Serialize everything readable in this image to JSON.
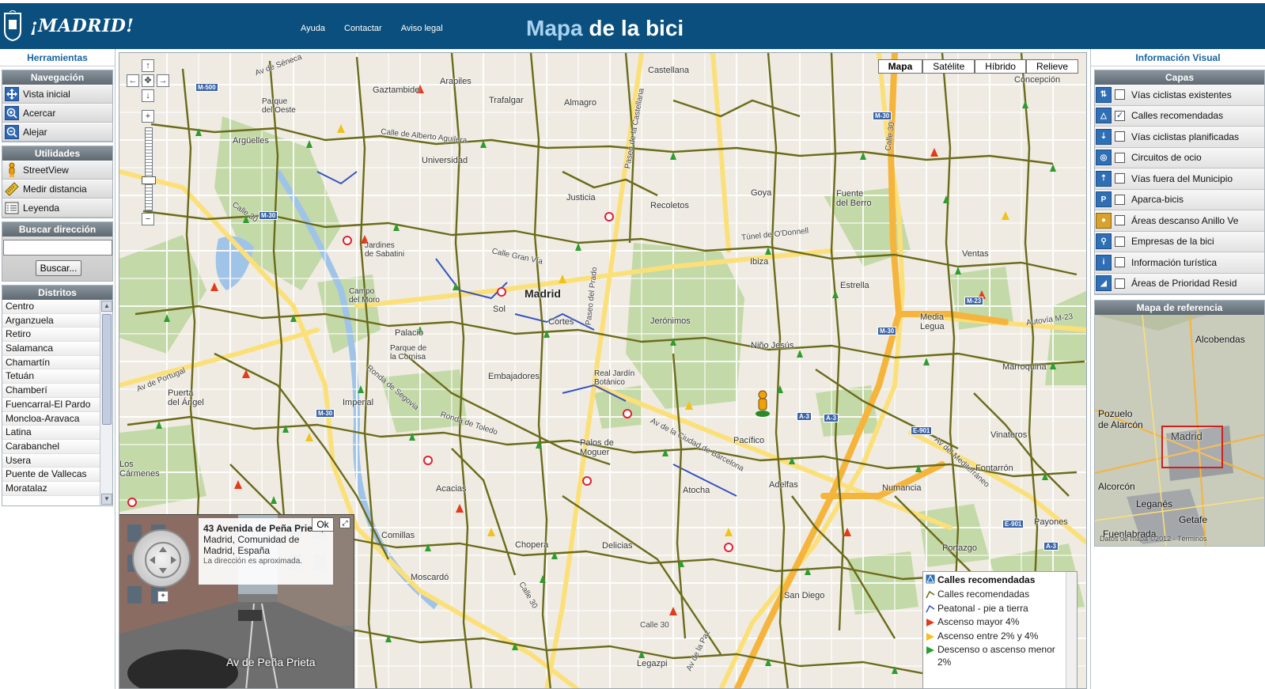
{
  "header": {
    "logo_text": "¡MADRID!",
    "nav": [
      "Ayuda",
      "Contactar",
      "Aviso legal"
    ],
    "title_part1": "Mapa",
    "title_part2": " de la bici"
  },
  "left": {
    "title": "Herramientas",
    "navegacion": {
      "title": "Navegación",
      "items": [
        {
          "label": "Vista inicial",
          "icon": "move-icon"
        },
        {
          "label": "Acercar",
          "icon": "zoom-in-icon"
        },
        {
          "label": "Alejar",
          "icon": "zoom-out-icon"
        }
      ]
    },
    "utilidades": {
      "title": "Utilidades",
      "items": [
        {
          "label": "StreetView",
          "icon": "pegman-icon"
        },
        {
          "label": "Medir distancia",
          "icon": "ruler-icon"
        },
        {
          "label": "Leyenda",
          "icon": "legend-icon"
        }
      ]
    },
    "buscar": {
      "title": "Buscar dirección",
      "value": "",
      "button": "Buscar..."
    },
    "distritos": {
      "title": "Distritos",
      "items": [
        "Centro",
        "Arganzuela",
        "Retiro",
        "Salamanca",
        "Chamartín",
        "Tetuán",
        "Chamberí",
        "Fuencarral-El Pardo",
        "Moncloa-Aravaca",
        "Latina",
        "Carabanchel",
        "Usera",
        "Puente de Vallecas",
        "Moratalaz"
      ]
    }
  },
  "map": {
    "types": [
      "Mapa",
      "Satélite",
      "Híbrido",
      "Relieve"
    ],
    "active_type": "Mapa",
    "labels": {
      "madrid": "Madrid",
      "arapiles": "Arapiles",
      "castellana": "Castellana",
      "gaztambide": "Gaztambide",
      "trafalgar": "Trafalgar",
      "almagro": "Almagro",
      "concepcion": "Concepción",
      "arguelles": "Argüelles",
      "universidad": "Universidad",
      "recoletos": "Recoletos",
      "goya": "Goya",
      "justicia": "Justicia",
      "ibiza": "Ibiza",
      "ventas": "Ventas",
      "palacio": "Palacio",
      "sol": "Sol",
      "cortes": "Cortes",
      "jeronimos": "Jerónimos",
      "nino_jesus": "Niño Jesús",
      "media_legua": "Media\nLegua",
      "embajadores": "Embajadores",
      "imperial": "Imperial",
      "marroquina": "Marroquina",
      "puerta_angel": "Puerta\ndel Ángel",
      "pacifico": "Pacífico",
      "vinateros": "Vinateros",
      "adelfas": "Adelfas",
      "fontarron": "Fontarrón",
      "numancia": "Numancia",
      "atocha": "Atocha",
      "acacias": "Acacias",
      "chopera": "Chopera",
      "delicias": "Delicias",
      "comillas": "Comillas",
      "moscardo": "Moscardó",
      "portazgo": "Portazgo",
      "san_diego": "San Diego",
      "legazpi": "Legazpi",
      "payones": "Payones",
      "los_carmenes": "Los\nCármenes",
      "calle30_a": "Calle 30",
      "calle30_b": "Calle 30",
      "calle30_c": "Calle 30",
      "calle30_d": "Calle 30",
      "av_seneca": "Av de Séneca",
      "av_portugal": "Av de Portugal",
      "av_ciudad_barcelona": "Av de la Ciudad de Barcelona",
      "av_mediterraneo": "Av del Mediterráneo",
      "autovia_m23": "Autovía M-23",
      "tunel_odonnell": "Túnel de O'Donnell",
      "ronda_segovia": "Ronda de Segovia",
      "ronda_toledo": "Ronda de Toledo",
      "calle_gran_via": "Calle Gran Vía",
      "calle_alberto_aguilera": "Calle de Alberto Aguilera",
      "paseo_prado": "Paseo del Prado",
      "paseo_castellana": "Paseo de la Castellana",
      "av_paz": "Av de la Paz",
      "parque_oeste": "Parque\ndel Oeste",
      "real_jardin": "Real Jardín\nBotánico",
      "parque_cornisa": "Parque de\nla Cornisa",
      "campo_moro": "Campo\ndel Moro",
      "jardines_sabatini": "Jardines\nde Sabatini",
      "fuente_berro": "Fuente\ndel Berro",
      "estrella": "Estrella",
      "palos_moguer": "Palos de\nMoguer"
    },
    "hwy_shields": [
      "M-500",
      "M-30",
      "M-30",
      "M-30",
      "M-23",
      "M-30",
      "A-3",
      "A-3",
      "E-901",
      "E-901",
      "A-3"
    ],
    "streetview": {
      "address_bold": "43 Avenida de Peña Prieta",
      "address_rest": ", Madrid, Comunidad de Madrid, España",
      "note": "La dirección es aproximada.",
      "ok": "Ok",
      "street_label": "Av de Peña Prieta"
    },
    "legend": {
      "title": "Calles recomendadas",
      "items": [
        {
          "label": "Calles recomendadas",
          "color": "#6b6b1a"
        },
        {
          "label": "Peatonal - pie a tierra",
          "color": "#3553c0"
        },
        {
          "label": "Ascenso mayor 4%",
          "color": "#e23b1c"
        },
        {
          "label": "Ascenso entre 2% y 4%",
          "color": "#f1c21b"
        },
        {
          "label": "Descenso o ascenso menor 2%",
          "color": "#2f9c2f"
        }
      ]
    }
  },
  "right": {
    "title": "Información Visual",
    "capas": {
      "title": "Capas",
      "items": [
        {
          "label": "Vías ciclistas existentes",
          "checked": false
        },
        {
          "label": "Calles recomendadas",
          "checked": true
        },
        {
          "label": "Vías ciclistas planificadas",
          "checked": false
        },
        {
          "label": "Circuitos de ocio",
          "checked": false
        },
        {
          "label": "Vías fuera del Municipio",
          "checked": false
        },
        {
          "label": "Aparca-bicis",
          "checked": false
        },
        {
          "label": "Áreas descanso Anillo Ve",
          "checked": false
        },
        {
          "label": "Empresas de la bici",
          "checked": false
        },
        {
          "label": "Información turística",
          "checked": false
        },
        {
          "label": "Áreas de Prioridad Resid",
          "checked": false
        }
      ]
    },
    "refmap": {
      "title": "Mapa de referencia",
      "labels": [
        "Alcobendas",
        "Madrid",
        "Pozuelo\nde Alarcón",
        "Alcorcón",
        "Leganés",
        "Getafe",
        "Fuenlabrada"
      ],
      "footer": "Datos de mapa ©2012 · Términos"
    }
  }
}
